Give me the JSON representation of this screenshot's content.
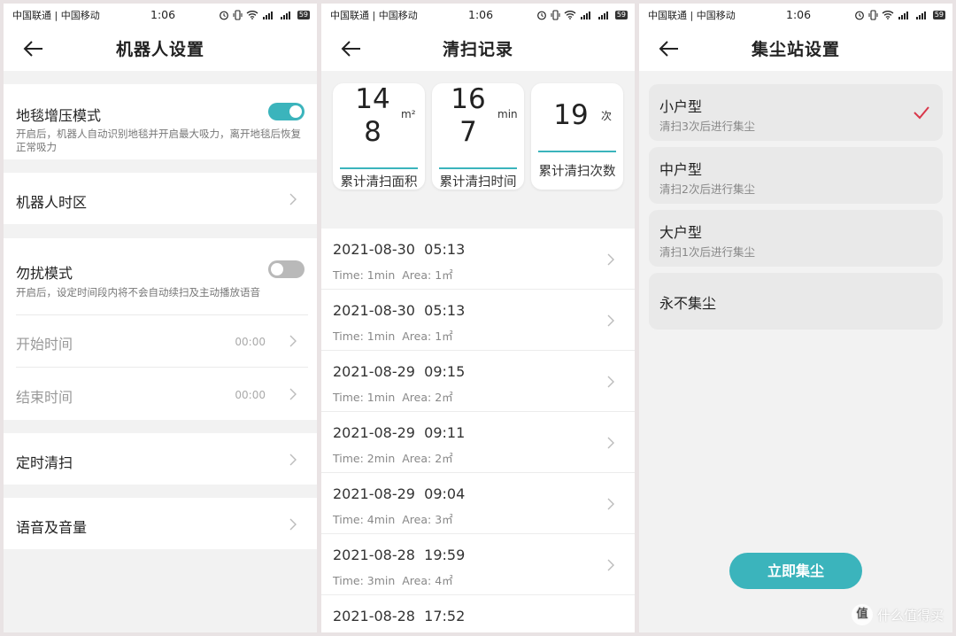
{
  "status_bar": {
    "carriers": "中国联通 | 中国移动",
    "time": "1:06",
    "battery": "59",
    "icons": [
      "alarm-icon",
      "vibrate-icon",
      "wifi-icon",
      "signal-icon",
      "signal-icon",
      "battery-icon"
    ]
  },
  "robot_settings": {
    "title": "机器人设置",
    "carpet": {
      "title": "地毯增压模式",
      "desc": "开启后，机器人自动识别地毯并开启最大吸力，离开地毯后恢复正常吸力",
      "enabled": true
    },
    "timezone": {
      "title": "机器人时区"
    },
    "dnd": {
      "title": "勿扰模式",
      "desc": "开启后，设定时间段内将不会自动续扫及主动播放语音",
      "enabled": false,
      "start_label": "开始时间",
      "start_value": "00:00",
      "end_label": "结束时间",
      "end_value": "00:00"
    },
    "schedule": {
      "title": "定时清扫"
    },
    "voice": {
      "title": "语音及音量"
    }
  },
  "clean_records": {
    "title": "清扫记录",
    "stats": [
      {
        "value_line1": "14",
        "value_line2": "8",
        "unit": "m²",
        "label": "累计清扫面积"
      },
      {
        "value_line1": "16",
        "value_line2": "7",
        "unit": "min",
        "label": "累计清扫时间"
      },
      {
        "value": "19",
        "unit": "次",
        "label": "累计清扫次数"
      }
    ],
    "records": [
      {
        "datetime": "2021-08-30  05:13",
        "meta": "Time: 1min  Area: 1㎡"
      },
      {
        "datetime": "2021-08-30  05:13",
        "meta": "Time: 1min  Area: 1㎡"
      },
      {
        "datetime": "2021-08-29  09:15",
        "meta": "Time: 1min  Area: 2㎡"
      },
      {
        "datetime": "2021-08-29  09:11",
        "meta": "Time: 2min  Area: 2㎡"
      },
      {
        "datetime": "2021-08-29  09:04",
        "meta": "Time: 4min  Area: 3㎡"
      },
      {
        "datetime": "2021-08-28  19:59",
        "meta": "Time: 3min  Area: 4㎡"
      },
      {
        "datetime": "2021-08-28  17:52",
        "meta": ""
      }
    ]
  },
  "dust_station": {
    "title": "集尘站设置",
    "options": [
      {
        "name": "小户型",
        "sub": "清扫3次后进行集尘",
        "selected": true
      },
      {
        "name": "中户型",
        "sub": "清扫2次后进行集尘",
        "selected": false
      },
      {
        "name": "大户型",
        "sub": "清扫1次后进行集尘",
        "selected": false
      },
      {
        "name": "永不集尘",
        "sub": "",
        "selected": false
      }
    ],
    "button_label": "立即集尘"
  },
  "watermark": {
    "badge": "值",
    "text": "什么值得买"
  },
  "colors": {
    "accent": "#3bb4bc",
    "check": "#d9374a",
    "background": "#f2f2f2"
  }
}
